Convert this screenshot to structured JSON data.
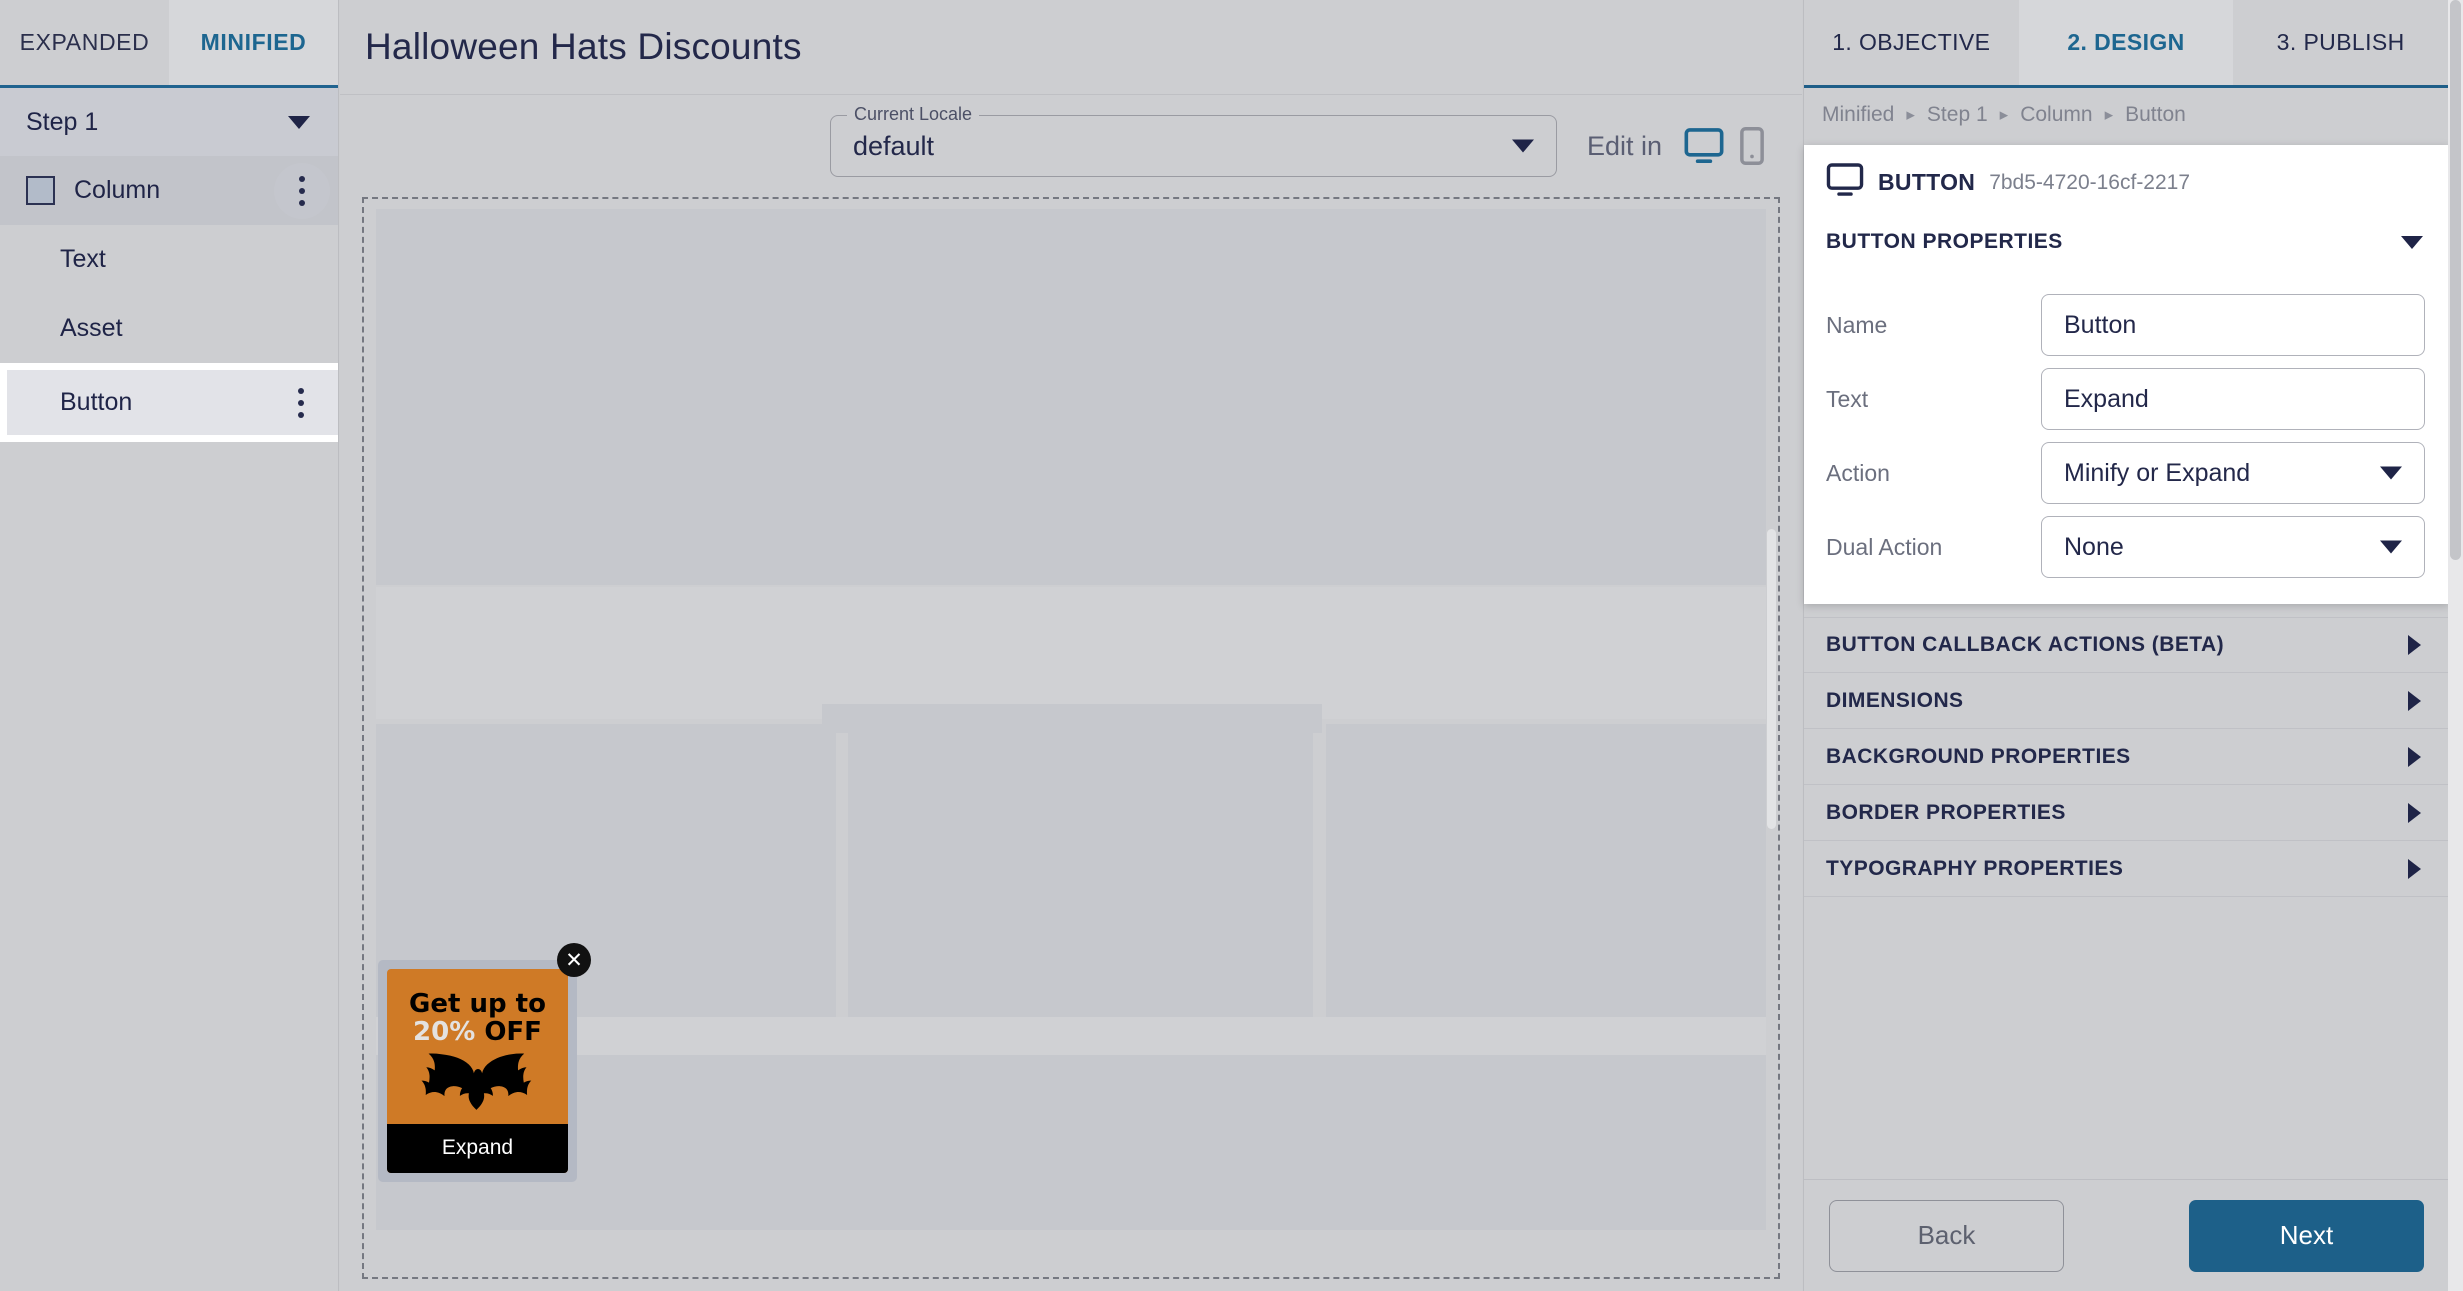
{
  "sidebar": {
    "tabs": [
      {
        "label": "EXPANDED",
        "active": false
      },
      {
        "label": "MINIFIED",
        "active": true
      }
    ],
    "step": {
      "label": "Step 1"
    },
    "layers": [
      {
        "label": "Column",
        "level": 1,
        "selected": false,
        "has_swatch": true,
        "has_menu": true
      },
      {
        "label": "Text",
        "level": 2,
        "selected": false,
        "has_swatch": false,
        "has_menu": false
      },
      {
        "label": "Asset",
        "level": 2,
        "selected": false,
        "has_swatch": false,
        "has_menu": false
      },
      {
        "label": "Button",
        "level": 2,
        "selected": true,
        "has_swatch": false,
        "has_menu": true
      }
    ]
  },
  "center": {
    "title": "Halloween Hats Discounts",
    "locale": {
      "legend": "Current Locale",
      "value": "default"
    },
    "edit_in_label": "Edit in",
    "devices": [
      {
        "name": "desktop",
        "active": true
      },
      {
        "name": "mobile",
        "active": false
      }
    ],
    "popup": {
      "headline_line1": "Get up to",
      "headline_percent": "20%",
      "headline_suffix": " OFF",
      "button_label": "Expand",
      "close_label": "✕",
      "background_color": "#cf7a26",
      "button_color": "#000000"
    }
  },
  "right": {
    "tabs": [
      {
        "label": "1. OBJECTIVE",
        "active": false
      },
      {
        "label": "2. DESIGN",
        "active": true
      },
      {
        "label": "3. PUBLISH",
        "active": false
      }
    ],
    "breadcrumb": [
      "Minified",
      "Step 1",
      "Column",
      "Button"
    ],
    "breadcrumb_separator": "▸",
    "element": {
      "kind": "BUTTON",
      "uid": "7bd5-4720-16cf-2217",
      "icon": "monitor-icon"
    },
    "properties_section": {
      "title": "BUTTON PROPERTIES",
      "expanded": true,
      "fields": [
        {
          "label": "Name",
          "value": "Button",
          "type": "text"
        },
        {
          "label": "Text",
          "value": "Expand",
          "type": "text"
        },
        {
          "label": "Action",
          "value": "Minify or Expand",
          "type": "select"
        },
        {
          "label": "Dual Action",
          "value": "None",
          "type": "select"
        }
      ]
    },
    "accordions": [
      {
        "label": "BUTTON CALLBACK ACTIONS (BETA)",
        "expanded": false
      },
      {
        "label": "DIMENSIONS",
        "expanded": false
      },
      {
        "label": "BACKGROUND PROPERTIES",
        "expanded": false
      },
      {
        "label": "BORDER PROPERTIES",
        "expanded": false
      },
      {
        "label": "TYPOGRAPHY PROPERTIES",
        "expanded": false
      }
    ],
    "footer": {
      "back_label": "Back",
      "next_label": "Next"
    }
  },
  "colors": {
    "accent": "#1d6690",
    "primary_button": "#1d6089",
    "text_dark": "#22284a",
    "text_muted": "#6b6f7e",
    "panel_bg": "#cdced1"
  }
}
